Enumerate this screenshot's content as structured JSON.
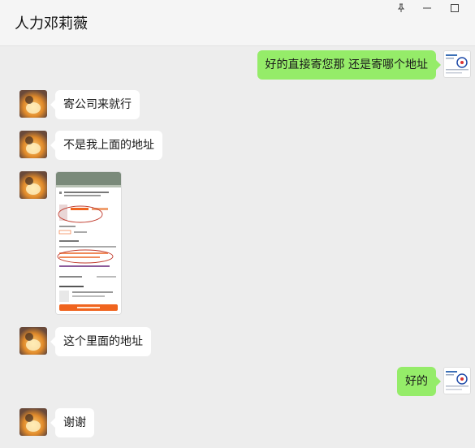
{
  "header": {
    "title": "人力邓莉薇",
    "controls": [
      "pin-icon",
      "minimize-icon",
      "maximize-icon"
    ]
  },
  "messages": [
    {
      "side": "right",
      "type": "text",
      "text": "好的直接寄您那 还是寄哪个地址"
    },
    {
      "side": "left",
      "type": "text",
      "text": "寄公司来就行"
    },
    {
      "side": "left",
      "type": "text",
      "text": "不是我上面的地址"
    },
    {
      "side": "left",
      "type": "image",
      "alt_icon": "screenshot-thumbnail"
    },
    {
      "side": "left",
      "type": "text",
      "text": "这个里面的地址"
    },
    {
      "side": "right",
      "type": "text",
      "text": "好的"
    },
    {
      "side": "left",
      "type": "text",
      "text": "谢谢"
    }
  ],
  "colors": {
    "background": "#ededed",
    "self_bubble": "#95ec69",
    "other_bubble": "#ffffff",
    "accent_orange": "#f0641e",
    "annotation_red": "#c0392b"
  }
}
